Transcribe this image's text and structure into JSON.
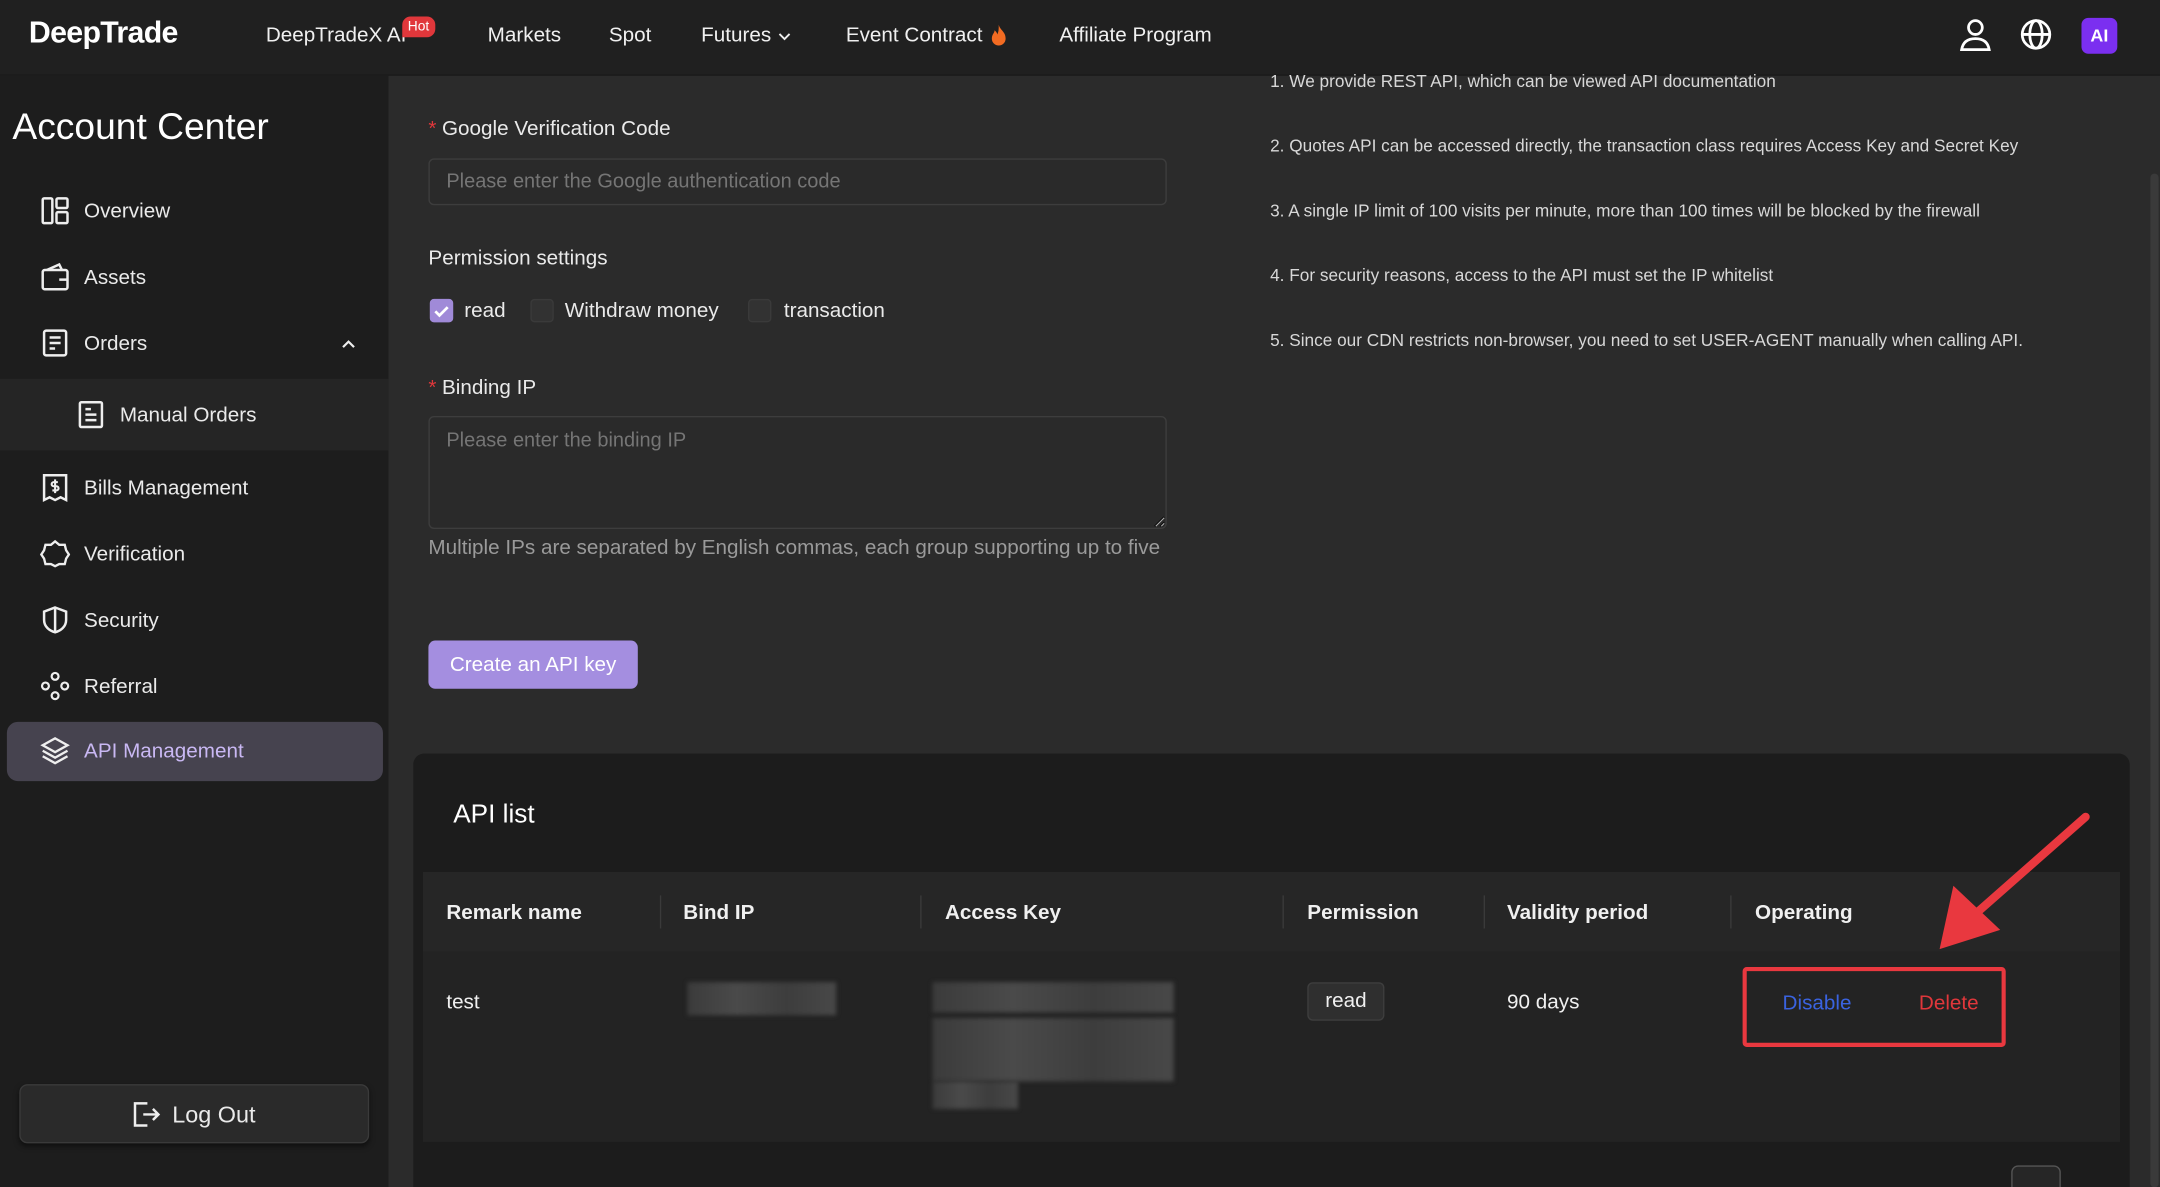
{
  "header": {
    "logo": "DeepTrade",
    "nav": [
      "DeepTradeX AI",
      "Markets",
      "Spot",
      "Futures",
      "Event Contract",
      "Affiliate Program"
    ],
    "hot_badge": "Hot",
    "ai_badge": "AI"
  },
  "sidebar": {
    "title": "Account Center",
    "items": [
      "Overview",
      "Assets",
      "Orders",
      "Manual Orders",
      "Bills Management",
      "Verification",
      "Security",
      "Referral",
      "API Management"
    ],
    "logout": "Log Out"
  },
  "form": {
    "google_label": "Google Verification Code",
    "google_placeholder": "Please enter the Google authentication code",
    "permission_label": "Permission settings",
    "permissions": [
      "read",
      "Withdraw money",
      "transaction"
    ],
    "ip_label": "Binding IP",
    "ip_placeholder": "Please enter the binding IP",
    "ip_hint": "Multiple IPs are separated by English commas, each group supporting up to five",
    "create_button": "Create an API key"
  },
  "notes": [
    "1. We provide REST API, which can be viewed API documentation",
    "2. Quotes API can be accessed directly, the transaction class requires Access Key and Secret Key",
    "3. A single IP limit of 100 visits per minute, more than 100 times will be blocked by the firewall",
    "4. For security reasons, access to the API must set the IP whitelist",
    "5. Since our CDN restricts non-browser, you need to set USER-AGENT manually when calling API."
  ],
  "api_list": {
    "title": "API list",
    "columns": [
      "Remark name",
      "Bind IP",
      "Access Key",
      "Permission",
      "Validity period",
      "Operating"
    ],
    "rows": [
      {
        "remark": "test",
        "permission": "read",
        "validity": "90 days",
        "disable": "Disable",
        "delete": "Delete"
      }
    ]
  },
  "colors": {
    "accent": "#a48ee0",
    "danger": "#e0373b",
    "link": "#3a63e0"
  }
}
